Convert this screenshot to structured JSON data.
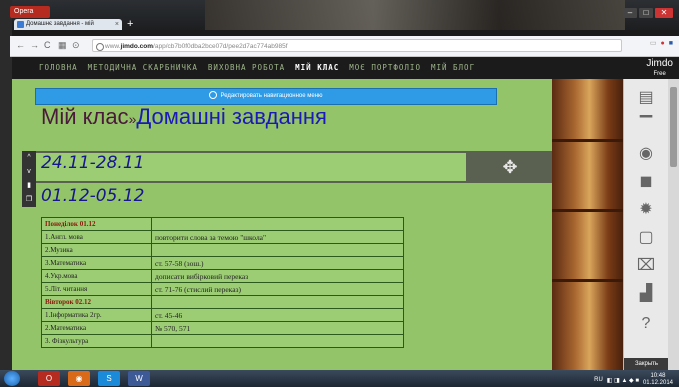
{
  "browser": {
    "menu_label": "Opera",
    "tab_title": "Домашнє завдання - мій",
    "tab_close": "×",
    "new_tab": "+",
    "url_prefix": "www.",
    "url_host": "jimdo.com",
    "url_path": "/app/cb7b0f0dba2bce07d/pee2d7ac774ab985f"
  },
  "site_nav": {
    "items": [
      "ГОЛОВНА",
      "МЕТОДИЧНА СКАРБНИЧКА",
      "ВИХОВНА РОБОТА",
      "МІЙ КЛАС",
      "МОЄ ПОРТФОЛІО",
      "МІЙ БЛОГ"
    ],
    "active": "МІЙ КЛАС"
  },
  "jimdo": {
    "logo": "Jimdo",
    "plan": "Free",
    "collapse_label": "Закрыть"
  },
  "edit_nav_label": "Редактировать навигационное меню",
  "heading": {
    "part1": "Мій клас",
    "separator": "»",
    "part2": "Домашні завдання"
  },
  "dates": [
    "24.11-28.11",
    "01.12-05.12"
  ],
  "schedule": [
    {
      "subject": "Понеділок 01.12",
      "task": "",
      "day": true
    },
    {
      "subject": "1.Англ. мова",
      "task": "повторити слова за темою \"школа\""
    },
    {
      "subject": "2.Музика",
      "task": ""
    },
    {
      "subject": "3.Математика",
      "task": "ст. 57-58 (зош.)"
    },
    {
      "subject": "4.Укр.мова",
      "task": "дописати вибірковий переказ"
    },
    {
      "subject": "5.Літ. читання",
      "task": "ст. 71-76 (стислий переказ)"
    },
    {
      "subject": "Вівторок 02.12",
      "task": "",
      "day": true
    },
    {
      "subject": "1.Інформатика 2гр.",
      "task": "ст. 45-46"
    },
    {
      "subject": "2.Математика",
      "task": "№ 570, 571"
    },
    {
      "subject": "3. Фізкультура",
      "task": ""
    }
  ],
  "taskbar": {
    "lang": "RU",
    "time": "10:48",
    "date": "01.12.2014"
  }
}
